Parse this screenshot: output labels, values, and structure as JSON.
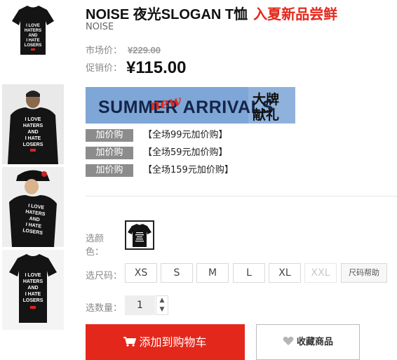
{
  "product": {
    "title": "NOISE 夜光SLOGAN T恤",
    "promo": "入夏新品尝鲜",
    "brand": "NOISE"
  },
  "price": {
    "market_label": "市场价：",
    "market_value": "¥229.00",
    "sale_label": "促销价：",
    "sale_value": "¥115.00"
  },
  "banner": {
    "text_main": "SUMMER ARRIVALS",
    "text_overlay": "new",
    "text_cn_1": "大牌",
    "text_cn_2": "献礼"
  },
  "addons": [
    {
      "tag": "加价购",
      "text": "【全场99元加价购】"
    },
    {
      "tag": "加价购",
      "text": "【全场59元加价购】"
    },
    {
      "tag": "加价购",
      "text": "【全场159元加价购】"
    }
  ],
  "shirt_print": [
    "I LOVE",
    "HATERS",
    "AND",
    "I HATE",
    "LOSERS"
  ],
  "options": {
    "color_label": "选颜色：",
    "size_label": "选尺码：",
    "sizes": [
      "XS",
      "S",
      "M",
      "L",
      "XL",
      "XXL"
    ],
    "size_help": "尺码帮助",
    "qty_label": "选数量：",
    "qty_value": "1"
  },
  "actions": {
    "cart": "添加到购物车",
    "favorite": "收藏商品"
  },
  "colors": {
    "accent": "#e4271b",
    "banner_bg": "#7ea6d6"
  }
}
